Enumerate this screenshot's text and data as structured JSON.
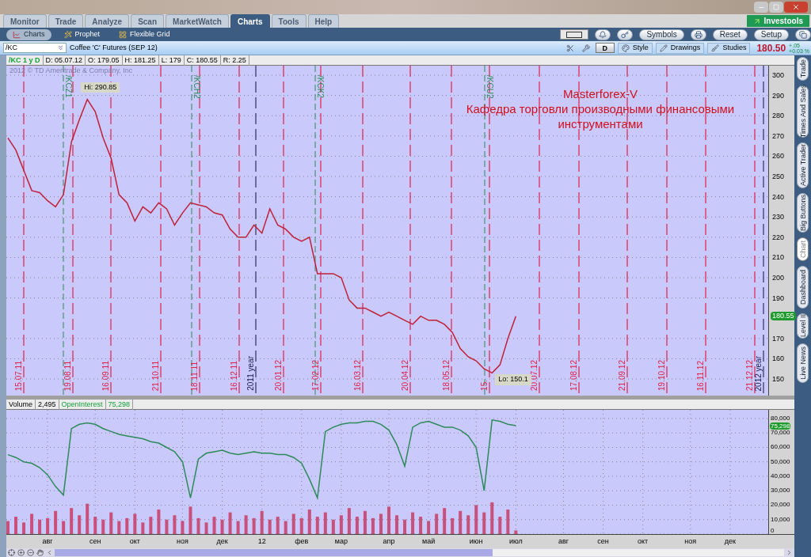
{
  "main_tabs": [
    {
      "label": "Monitor",
      "selected": false
    },
    {
      "label": "Trade",
      "selected": false
    },
    {
      "label": "Analyze",
      "selected": false
    },
    {
      "label": "Scan",
      "selected": false
    },
    {
      "label": "MarketWatch",
      "selected": false
    },
    {
      "label": "Charts",
      "selected": true
    },
    {
      "label": "Tools",
      "selected": false
    },
    {
      "label": "Help",
      "selected": false
    }
  ],
  "brand_button": {
    "label": "Investools"
  },
  "sub_tabs": [
    {
      "label": "Charts",
      "selected": true
    },
    {
      "label": "Prophet",
      "selected": false
    },
    {
      "label": "Flexible Grid",
      "selected": false
    }
  ],
  "toolbar_buttons": [
    "Symbols",
    "Reset",
    "Setup"
  ],
  "symbol_bar": {
    "symbol": "/KC",
    "description": "Coffee 'C' Futures (SEP 12)",
    "period_button": "D",
    "buttons": [
      "Style",
      "Drawings",
      "Studies"
    ],
    "last_price": "180.50",
    "change": "+.05",
    "change_percent": "+0.03 %"
  },
  "info_bar": [
    "/KC 1 y D",
    "D: 05.07.12",
    "O: 179.05",
    "H: 181.25",
    "L: 179",
    "C: 180.55",
    "R: 2.25"
  ],
  "price_chart": {
    "copyright": "2012 © TD Ameritrade & Company, Inc",
    "high_label": "Hi: 290.85",
    "low_label": "Lo: 150.1",
    "current_price_tag": "180.55",
    "annotation": [
      "Masterforex-V",
      "Кафедра торговли производными финансовыми",
      "инструментами"
    ],
    "date_markers": [
      {
        "label": "15.07.11",
        "kind": "date"
      },
      {
        "label": "19.08.11",
        "kind": "date"
      },
      {
        "label": "16.09.11",
        "kind": "date"
      },
      {
        "label": "21.10.11",
        "kind": "date"
      },
      {
        "label": "18.11.11",
        "kind": "date"
      },
      {
        "label": "16.12.11",
        "kind": "date"
      },
      {
        "label": "2011 year",
        "kind": "year"
      },
      {
        "label": "20.01.12",
        "kind": "date"
      },
      {
        "label": "17.02.12",
        "kind": "date"
      },
      {
        "label": "16.03.12",
        "kind": "date"
      },
      {
        "label": "20.04.12",
        "kind": "date"
      },
      {
        "label": "18.05.12",
        "kind": "date"
      },
      {
        "label": "15.",
        "kind": "date"
      },
      {
        "label": "20.07.12",
        "kind": "date"
      },
      {
        "label": "17.08.12",
        "kind": "date"
      },
      {
        "label": "21.09.12",
        "kind": "date"
      },
      {
        "label": "19.10.12",
        "kind": "date"
      },
      {
        "label": "16.11.12",
        "kind": "date"
      },
      {
        "label": "21.12.12",
        "kind": "date"
      },
      {
        "label": "2012 year",
        "kind": "year"
      }
    ],
    "rollover_markers": [
      "/KCZ1",
      "/KCH2",
      "/KCK2",
      "/KCU2"
    ],
    "chart_data": {
      "type": "line",
      "grid": true,
      "categories": [
        null,
        null,
        null,
        null,
        null,
        null,
        null,
        null,
        null,
        null,
        null,
        null,
        null,
        null,
        null,
        null,
        null,
        null,
        null,
        null,
        null,
        null,
        null,
        null,
        null,
        null,
        null,
        null,
        null,
        null,
        null,
        null,
        null,
        null,
        null,
        null,
        null,
        null,
        null,
        null,
        null,
        null,
        null,
        null,
        null,
        null,
        null,
        null,
        null,
        null,
        null,
        null,
        null,
        null,
        null,
        null,
        null,
        null,
        null,
        null,
        null,
        null,
        null,
        null,
        null,
        null,
        null,
        null,
        null,
        null,
        null,
        null,
        null,
        null,
        null,
        null,
        null,
        null,
        null,
        null,
        null,
        null,
        null,
        null,
        null,
        null,
        null,
        null,
        null,
        null,
        null,
        null,
        null,
        null,
        null,
        null,
        null
      ],
      "ylim": [
        141.8,
        304.7
      ],
      "yticks": [
        150,
        160,
        170,
        190,
        200,
        210,
        220,
        230,
        240,
        250,
        260,
        270,
        280,
        290,
        300
      ],
      "series": [
        {
          "color": "#c0203a",
          "values": [
            269,
            263,
            253,
            243,
            242,
            238,
            235,
            241,
            267,
            278,
            288,
            282,
            269,
            259,
            241,
            237,
            228,
            235,
            232,
            237,
            234,
            226,
            232,
            237,
            236,
            235,
            232,
            231,
            224,
            220,
            220,
            226,
            222,
            234,
            226,
            224,
            220,
            218,
            220,
            202,
            202,
            202,
            200,
            189,
            185,
            185,
            183,
            181,
            183,
            181,
            179,
            177,
            181,
            179,
            179,
            177,
            173,
            165,
            161,
            159,
            155,
            153,
            157,
            170,
            181,
            null,
            null,
            null,
            null,
            null,
            null,
            null,
            null,
            null,
            null,
            null,
            null,
            null,
            null,
            null,
            null,
            null,
            null,
            null,
            null,
            null,
            null,
            null,
            null,
            null,
            null,
            null,
            null,
            null,
            null,
            null,
            null
          ]
        }
      ]
    }
  },
  "lower_pane": {
    "legend": [
      "2,495",
      "75,298"
    ],
    "current_value_tag": "75,298",
    "chart_data": {
      "type": "line",
      "grid": true,
      "categories": [
        null,
        null,
        null,
        null,
        null,
        "авг",
        null,
        null,
        null,
        null,
        null,
        "сен",
        null,
        null,
        null,
        null,
        "окт",
        null,
        null,
        null,
        null,
        null,
        "ноя",
        null,
        null,
        null,
        null,
        "дек",
        null,
        null,
        null,
        null,
        "12",
        null,
        null,
        null,
        null,
        "фев",
        null,
        null,
        null,
        null,
        "мар",
        null,
        null,
        null,
        null,
        null,
        "апр",
        null,
        null,
        null,
        null,
        "май",
        null,
        null,
        null,
        null,
        null,
        "июн",
        null,
        null,
        null,
        null,
        "июл",
        null,
        null,
        null,
        null,
        null,
        "авг",
        null,
        null,
        null,
        null,
        "сен",
        null,
        null,
        null,
        null,
        "окт",
        null,
        null,
        null,
        null,
        null,
        "ноя",
        null,
        null,
        null,
        null,
        "дек",
        null,
        null,
        null,
        null,
        null
      ],
      "ylim": [
        0,
        86000
      ],
      "yticks": [
        {
          "value": 0,
          "label": "0"
        },
        {
          "value": 10000,
          "label": "10,000"
        },
        {
          "value": 20000,
          "label": "20,000"
        },
        {
          "value": 30000,
          "label": "30,000"
        },
        {
          "value": 40000,
          "label": "40,000"
        },
        {
          "value": 50000,
          "label": "50,000"
        },
        {
          "value": 60000,
          "label": "60,000"
        },
        {
          "value": 70000,
          "label": "70,000"
        },
        {
          "value": 80000,
          "label": "80,000"
        }
      ],
      "series": [
        {
          "name": "Volume",
          "type": "bar",
          "color": "#c8507a",
          "values": [
            9000,
            12000,
            8000,
            14000,
            10000,
            11000,
            16000,
            9000,
            18000,
            13000,
            21000,
            12000,
            10000,
            15000,
            9000,
            11000,
            14000,
            8000,
            12000,
            17000,
            10000,
            13000,
            9000,
            19000,
            11000,
            8000,
            12000,
            10000,
            15000,
            9000,
            13000,
            11000,
            16000,
            10000,
            12000,
            9000,
            14000,
            11000,
            17000,
            12000,
            15000,
            10000,
            13000,
            18000,
            12000,
            16000,
            11000,
            14000,
            19000,
            13000,
            10000,
            15000,
            12000,
            9000,
            14000,
            18000,
            11000,
            16000,
            13000,
            20000,
            15000,
            22000,
            12000,
            17000,
            2500,
            null,
            null,
            null,
            null,
            null,
            null,
            null,
            null,
            null,
            null,
            null,
            null,
            null,
            null,
            null,
            null,
            null,
            null,
            null,
            null,
            null,
            null,
            null,
            null,
            null,
            null,
            null,
            null,
            null,
            null,
            null,
            null
          ]
        },
        {
          "name": "OpenInterest",
          "color": "#2e8a5a",
          "values": [
            55000,
            53000,
            50000,
            49000,
            46000,
            41000,
            33000,
            27000,
            73000,
            76000,
            77000,
            76000,
            73000,
            71000,
            69000,
            68000,
            67000,
            66000,
            64000,
            63000,
            60000,
            57000,
            50000,
            25000,
            52000,
            56000,
            57000,
            58000,
            56000,
            55000,
            56000,
            57000,
            56000,
            56000,
            55000,
            55000,
            53000,
            49000,
            38000,
            25000,
            71000,
            74000,
            76000,
            77000,
            77000,
            78000,
            78000,
            76000,
            72000,
            62000,
            47000,
            74000,
            77000,
            78000,
            76000,
            74000,
            74000,
            72000,
            68000,
            60000,
            30000,
            79000,
            78000,
            76000,
            75000,
            null,
            null,
            null,
            null,
            null,
            null,
            null,
            null,
            null,
            null,
            null,
            null,
            null,
            null,
            null,
            null,
            null,
            null,
            null,
            null,
            null,
            null,
            null,
            null,
            null,
            null,
            null,
            null,
            null,
            null,
            null,
            null
          ]
        }
      ]
    }
  },
  "side_tabs": [
    {
      "label": "Trade",
      "selected": false
    },
    {
      "label": "Times And Sales",
      "selected": false
    },
    {
      "label": "Active Trader",
      "selected": false
    },
    {
      "label": "Big Buttons",
      "selected": false
    },
    {
      "label": "Chart",
      "selected": true
    },
    {
      "label": "Dashboard",
      "selected": false
    },
    {
      "label": "Level II",
      "selected": false
    },
    {
      "label": "Live News",
      "selected": false
    }
  ]
}
